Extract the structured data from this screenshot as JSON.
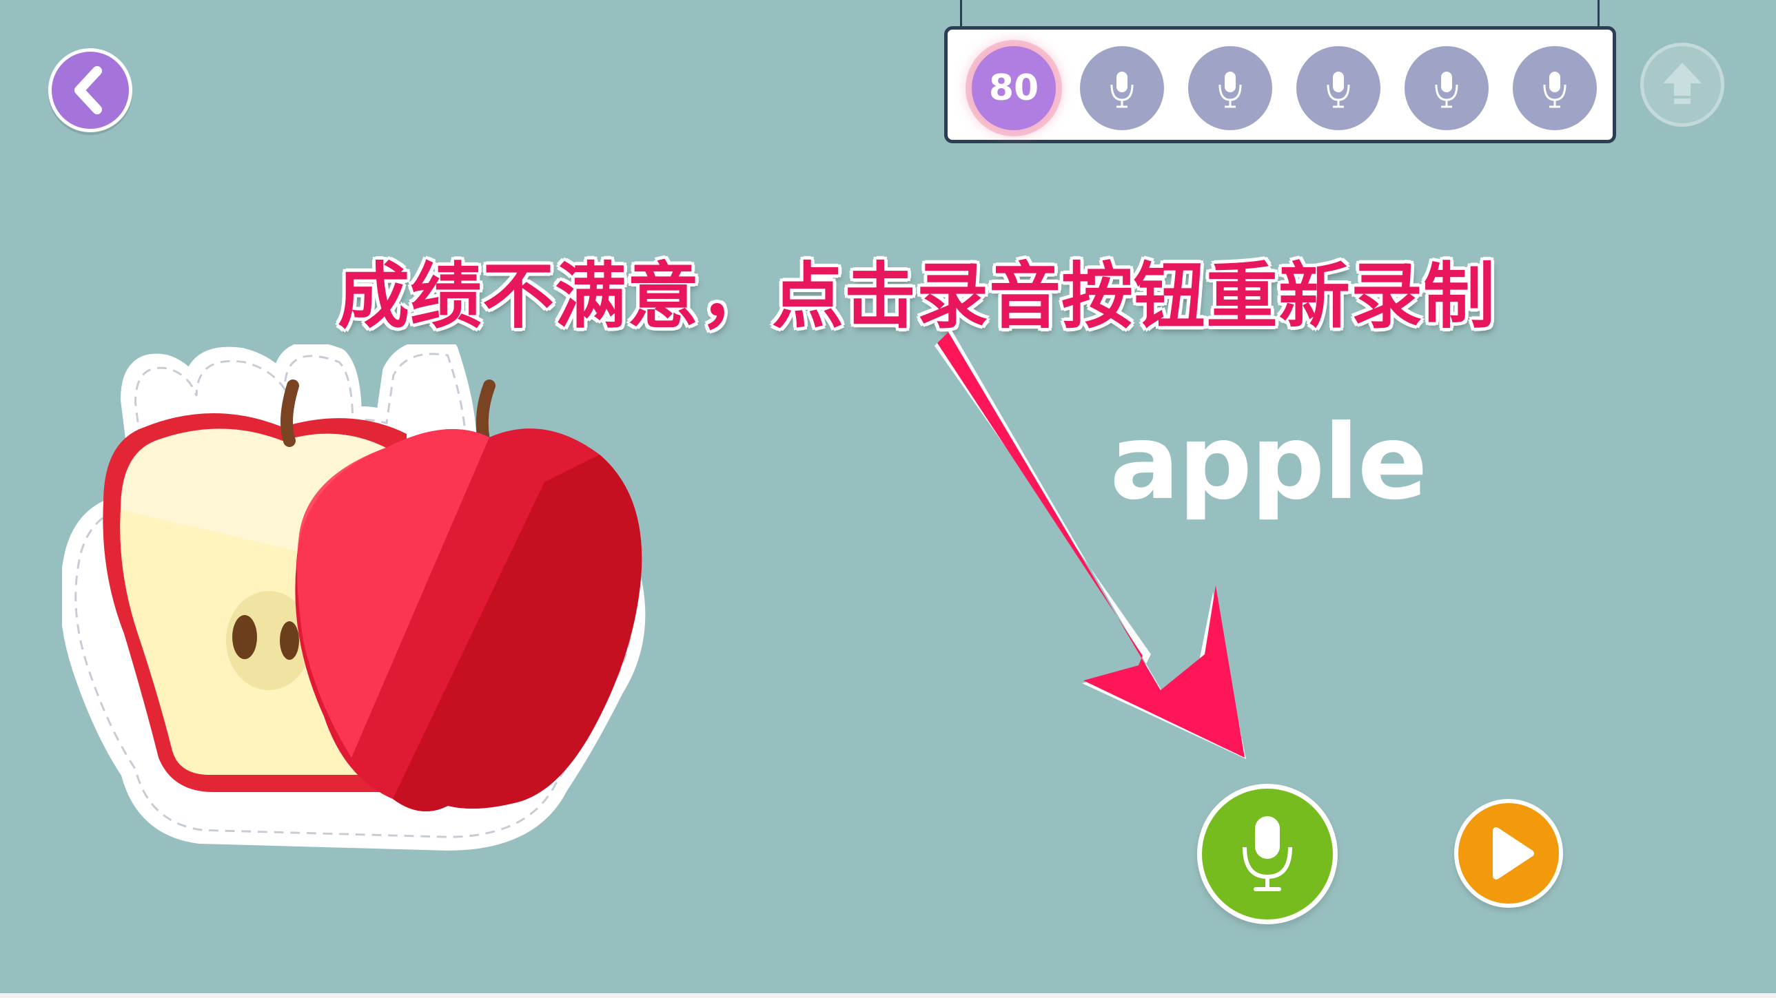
{
  "header": {
    "back_icon": "chevron-left-icon",
    "score": "80",
    "recording_slots": [
      {
        "icon": "mic-icon"
      },
      {
        "icon": "mic-icon"
      },
      {
        "icon": "mic-icon"
      },
      {
        "icon": "mic-icon"
      },
      {
        "icon": "mic-icon"
      }
    ],
    "upload_icon": "arrow-up-icon"
  },
  "instruction": "成绩不满意，点击录音按钮重新录制",
  "card": {
    "word": "apple",
    "image": "apple-illustration"
  },
  "controls": {
    "record_icon": "mic-icon",
    "play_icon": "play-icon"
  },
  "colors": {
    "background": "#98bfbf",
    "accent_purple": "#a474db",
    "score_purple": "#b07de0",
    "slot_gray": "#9fa3c6",
    "record_green": "#77bc1f",
    "play_orange": "#f29a0c",
    "annotation_pink": "#e8175d",
    "panel_border": "#2c3e54"
  }
}
